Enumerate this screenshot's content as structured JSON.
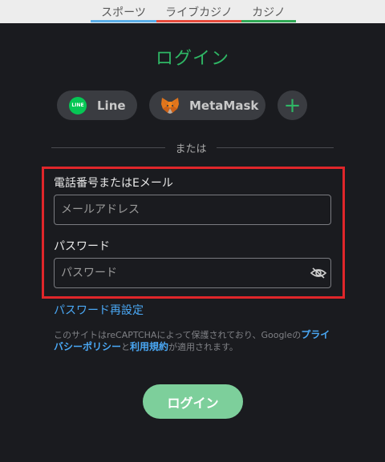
{
  "tabs": [
    {
      "label": "スポーツ",
      "color": "#5aaee8"
    },
    {
      "label": "ライブカジノ",
      "color": "#e84b3c"
    },
    {
      "label": "カジノ",
      "color": "#2fa955"
    }
  ],
  "title": "ログイン",
  "social": {
    "line_label": "Line",
    "line_logo_text": "LINE",
    "metamask_label": "MetaMask",
    "more_icon": "plus-icon"
  },
  "divider_text": "または",
  "form": {
    "phone_label": "電話番号またはEメール",
    "email_placeholder": "メールアドレス",
    "password_label": "パスワード",
    "password_placeholder": "パスワード",
    "eye_icon": "eye-off-icon"
  },
  "reset_link": "パスワード再設定",
  "notice": {
    "text1": "このサイトはreCAPTCHAによって保護されており、Googleの",
    "privacy_link": "プライバシーポリシー",
    "text2": "と",
    "terms_link": "利用規約",
    "text3": "が適用されます。"
  },
  "login_button": "ログイン",
  "colors": {
    "accent": "#2fb765",
    "link": "#4aa8f5",
    "highlight": "#e0262a",
    "button": "#7dcf9b"
  }
}
